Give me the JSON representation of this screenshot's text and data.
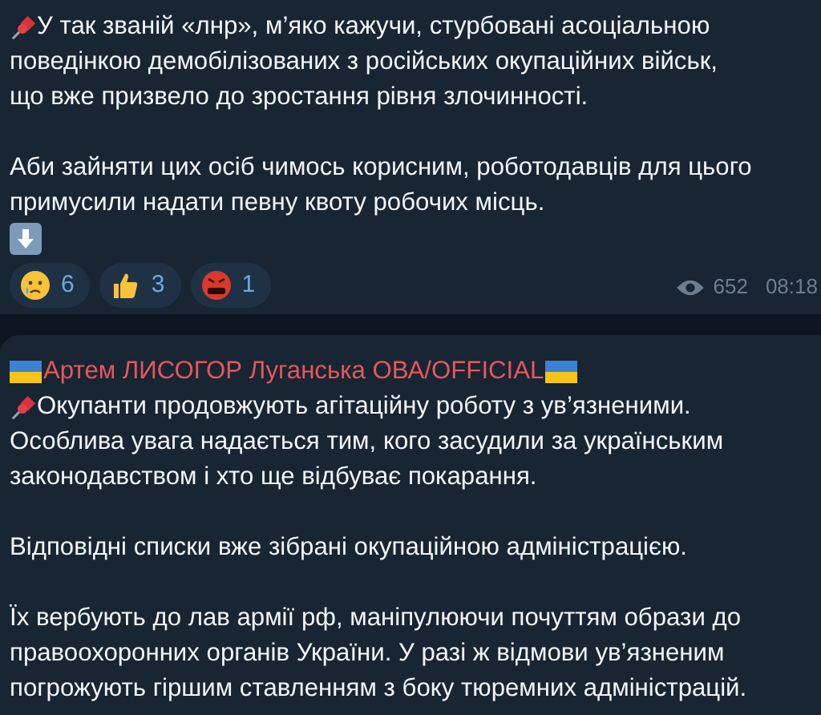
{
  "messages": [
    {
      "paragraphs": [
        {
          "kind": "pinned",
          "lines": [
            "У так званій «лнр», м’яко кажучи, стурбовані асоціальною",
            "поведінкою демобілізованих з російських окупаційних військ,",
            "що вже призвело до зростання рівня злочинності."
          ]
        },
        {
          "kind": "plain",
          "lines": [
            "Аби зайняти цих осіб чимось корисним, роботодавців для цього",
            "примусили надати певну квоту робочих місць."
          ]
        },
        {
          "kind": "arrow"
        }
      ],
      "reactions": [
        {
          "kind": "crying",
          "count": "6"
        },
        {
          "kind": "thumbs-up",
          "count": "3"
        },
        {
          "kind": "cursing",
          "count": "1"
        }
      ],
      "views": "652",
      "time": "08:18"
    },
    {
      "sender": "Артем ЛИСОГОР Луганська ОВА/OFFICIAL",
      "paragraphs": [
        {
          "kind": "pinned",
          "lines": [
            "Окупанти продовжують агітаційну роботу з ув’язненими.",
            "Особлива увага надається тим, кого засудили за українським",
            "законодавством і хто ще відбуває покарання."
          ]
        },
        {
          "kind": "plain",
          "lines": [
            "Відповідні списки вже зібрані окупаційною адміністрацією."
          ]
        },
        {
          "kind": "plain",
          "lines": [
            "Їх вербують до лав армії рф, маніпулюючи почуттям образи до",
            "правоохоронних органів України. У разі ж відмови ув’язненим",
            "погрожують гіршим ставленням з боку тюремних адміністрацій."
          ]
        }
      ]
    }
  ]
}
